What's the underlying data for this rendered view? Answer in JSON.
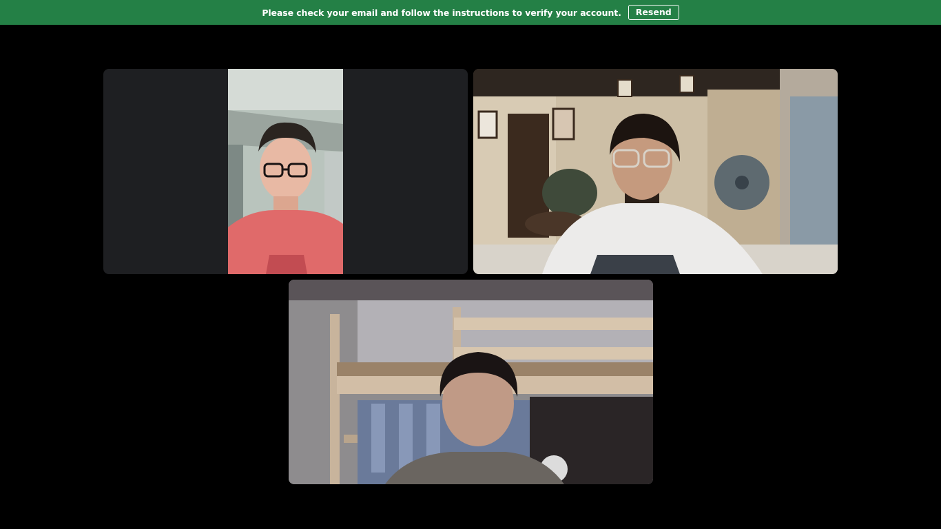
{
  "banner": {
    "message": "Please check your email and follow the instructions to verify your account.",
    "resend_label": "Resend",
    "background_color": "#248046"
  },
  "participants": [
    {
      "tile": "top-left",
      "video_orientation": "portrait"
    },
    {
      "tile": "top-right",
      "video_orientation": "landscape"
    },
    {
      "tile": "bottom-center",
      "video_orientation": "landscape"
    }
  ]
}
